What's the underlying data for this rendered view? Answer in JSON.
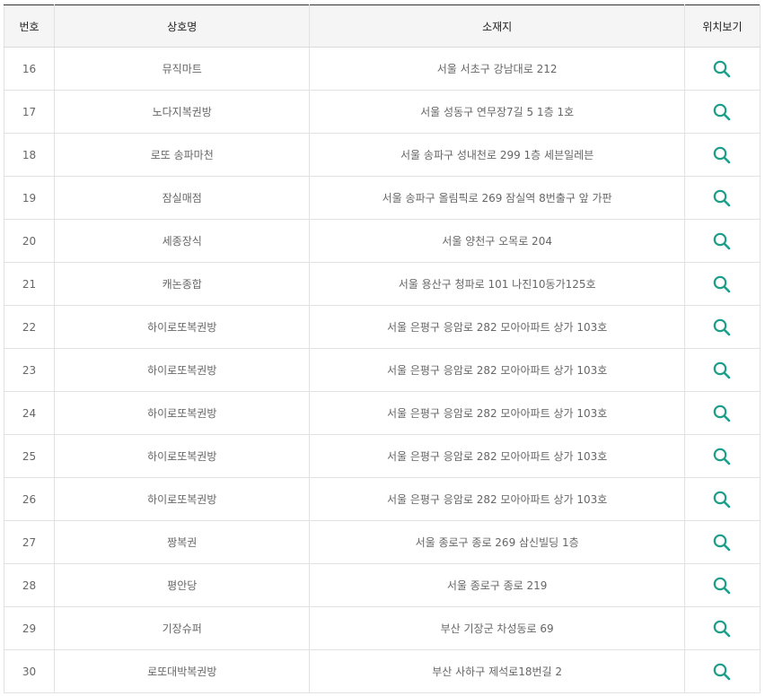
{
  "colors": {
    "accent": "#1a9e8a",
    "header_bg": "#f5f5f5",
    "header_border": "#333333",
    "text": "#666666"
  },
  "table": {
    "headers": {
      "no": "번호",
      "name": "상호명",
      "address": "소재지",
      "map": "위치보기"
    },
    "map_icon": "search-icon",
    "rows": [
      {
        "no": "16",
        "name": "뮤직마트",
        "address": "서울 서초구 강남대로 212"
      },
      {
        "no": "17",
        "name": "노다지복권방",
        "address": "서울 성동구 연무장7길 5 1층 1호"
      },
      {
        "no": "18",
        "name": "로또 송파마천",
        "address": "서울 송파구 성내천로 299 1층 세븐일레븐"
      },
      {
        "no": "19",
        "name": "잠실매점",
        "address": "서울 송파구 올림픽로 269 잠실역 8번출구 앞 가판"
      },
      {
        "no": "20",
        "name": "세종장식",
        "address": "서울 양천구 오목로 204"
      },
      {
        "no": "21",
        "name": "캐논종합",
        "address": "서울 용산구 청파로 101 나진10동가125호"
      },
      {
        "no": "22",
        "name": "하이로또복권방",
        "address": "서울 은평구 응암로 282 모아아파트 상가 103호"
      },
      {
        "no": "23",
        "name": "하이로또복권방",
        "address": "서울 은평구 응암로 282 모아아파트 상가 103호"
      },
      {
        "no": "24",
        "name": "하이로또복권방",
        "address": "서울 은평구 응암로 282 모아아파트 상가 103호"
      },
      {
        "no": "25",
        "name": "하이로또복권방",
        "address": "서울 은평구 응암로 282 모아아파트 상가 103호"
      },
      {
        "no": "26",
        "name": "하이로또복권방",
        "address": "서울 은평구 응암로 282 모아아파트 상가 103호"
      },
      {
        "no": "27",
        "name": "짱복권",
        "address": "서울 종로구 종로 269 삼신빌딩 1층"
      },
      {
        "no": "28",
        "name": "평안당",
        "address": "서울 종로구 종로 219"
      },
      {
        "no": "29",
        "name": "기장슈퍼",
        "address": "부산 기장군 차성동로 69"
      },
      {
        "no": "30",
        "name": "로또대박복권방",
        "address": "부산 사하구 제석로18번길 2"
      }
    ]
  }
}
